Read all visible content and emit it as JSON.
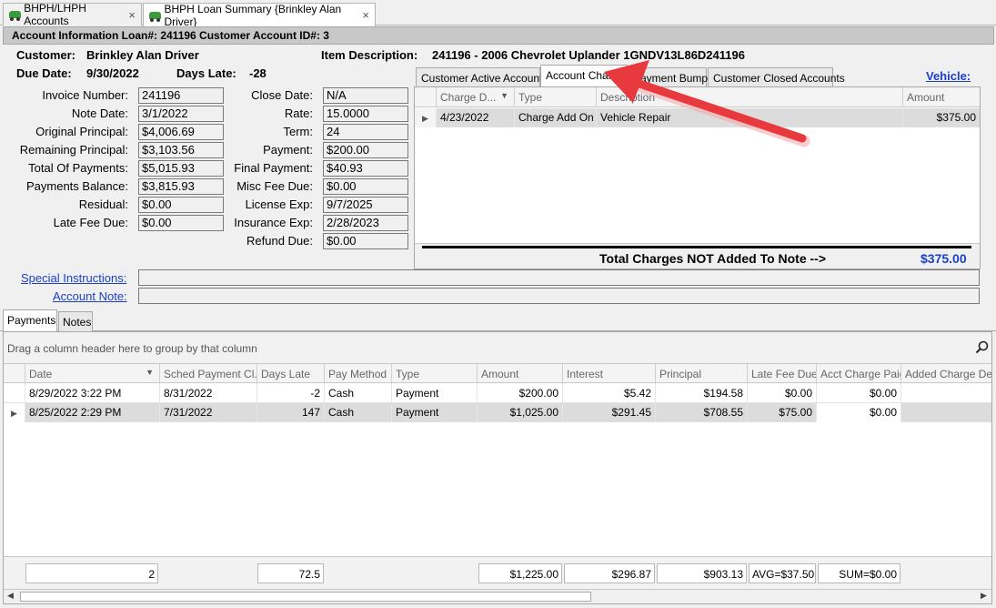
{
  "doc_tabs": [
    {
      "label": "BHPH/LHPH Accounts"
    },
    {
      "label": "BHPH Loan Summary {Brinkley Alan Driver}"
    }
  ],
  "tab_close_glyph": "×",
  "header_bar": "Account Information Loan#: 241196  Customer Account ID#: 3",
  "customer": {
    "label": "Customer:",
    "value": "Brinkley Alan Driver"
  },
  "due_date": {
    "label": "Due Date:",
    "value": "9/30/2022"
  },
  "days_late": {
    "label": "Days Late:",
    "value": "-28"
  },
  "item_description": {
    "label": "Item Description:",
    "value": "241196 - 2006 Chevrolet Uplander 1GNDV13L86D241196"
  },
  "left_fields": [
    {
      "label": "Invoice Number:",
      "value": "241196"
    },
    {
      "label": "Note Date:",
      "value": "3/1/2022"
    },
    {
      "label": "Original Principal:",
      "value": "$4,006.69"
    },
    {
      "label": "Remaining Principal:",
      "value": "$3,103.56"
    },
    {
      "label": "Total Of Payments:",
      "value": "$5,015.93"
    },
    {
      "label": "Payments Balance:",
      "value": "$3,815.93"
    },
    {
      "label": "Residual:",
      "value": "$0.00"
    },
    {
      "label": "Late Fee Due:",
      "value": "$0.00"
    }
  ],
  "right_fields": [
    {
      "label": "Close Date:",
      "value": "N/A"
    },
    {
      "label": "Rate:",
      "value": "15.0000"
    },
    {
      "label": "Term:",
      "value": "24"
    },
    {
      "label": "Payment:",
      "value": "$200.00"
    },
    {
      "label": "Final Payment:",
      "value": "$40.93"
    },
    {
      "label": "Misc Fee Due:",
      "value": "$0.00"
    },
    {
      "label": "License Exp:",
      "value": "9/7/2025"
    },
    {
      "label": "Insurance Exp:",
      "value": "2/28/2023"
    },
    {
      "label": "Refund Due:",
      "value": "$0.00"
    }
  ],
  "special_instructions": {
    "label": "Special Instructions:",
    "value": ""
  },
  "account_note": {
    "label": "Account Note:",
    "value": ""
  },
  "inner_tabs": [
    {
      "label": "Customer Active Accounts"
    },
    {
      "label": "Account Charges"
    },
    {
      "label": "Payment Bumps"
    },
    {
      "label": "Customer Closed Accounts"
    }
  ],
  "active_inner_tab": "Account Charges",
  "vehicle_link": "Vehicle:",
  "charges_grid": {
    "columns": [
      "Charge D...",
      "Type",
      "Description",
      "Amount"
    ],
    "rows": [
      {
        "date": "4/23/2022",
        "type": "Charge Add On",
        "description": "Vehicle Repair",
        "amount": "$375.00"
      }
    ]
  },
  "total_charges": {
    "label": "Total Charges NOT Added To Note -->",
    "value": "$375.00"
  },
  "bottom_tabs": [
    {
      "label": "Payments"
    },
    {
      "label": "Notes"
    }
  ],
  "group_hint": "Drag a column header here to group by that column",
  "payments_grid": {
    "columns": [
      "Date",
      "Sched Payment Cl...",
      "Days Late",
      "Pay Method",
      "Type",
      "Amount",
      "Interest",
      "Principal",
      "Late Fee Due",
      "Acct Charge Paid",
      "Added Charge Desc"
    ],
    "rows": [
      {
        "date": "8/29/2022 3:22 PM",
        "sched": "8/31/2022",
        "days_late": "-2",
        "method": "Cash",
        "type": "Payment",
        "amount": "$200.00",
        "interest": "$5.42",
        "principal": "$194.58",
        "late_fee": "$0.00",
        "acct_charge": "$0.00",
        "added_desc": ""
      },
      {
        "date": "8/25/2022 2:29 PM",
        "sched": "7/31/2022",
        "days_late": "147",
        "method": "Cash",
        "type": "Payment",
        "amount": "$1,025.00",
        "interest": "$291.45",
        "principal": "$708.55",
        "late_fee": "$75.00",
        "acct_charge": "$0.00",
        "added_desc": ""
      }
    ],
    "footer": {
      "count": "2",
      "days_late_avg": "72.5",
      "amount_sum": "$1,225.00",
      "interest_sum": "$296.87",
      "principal_sum": "$903.13",
      "late_fee": "AVG=$37.50",
      "acct_charge": "SUM=$0.00"
    }
  },
  "colors": {
    "link": "#1a3fc8",
    "arrow": "#e8393f",
    "header_bg": "#c8c8c8",
    "selected_row": "#dcdcdc"
  }
}
